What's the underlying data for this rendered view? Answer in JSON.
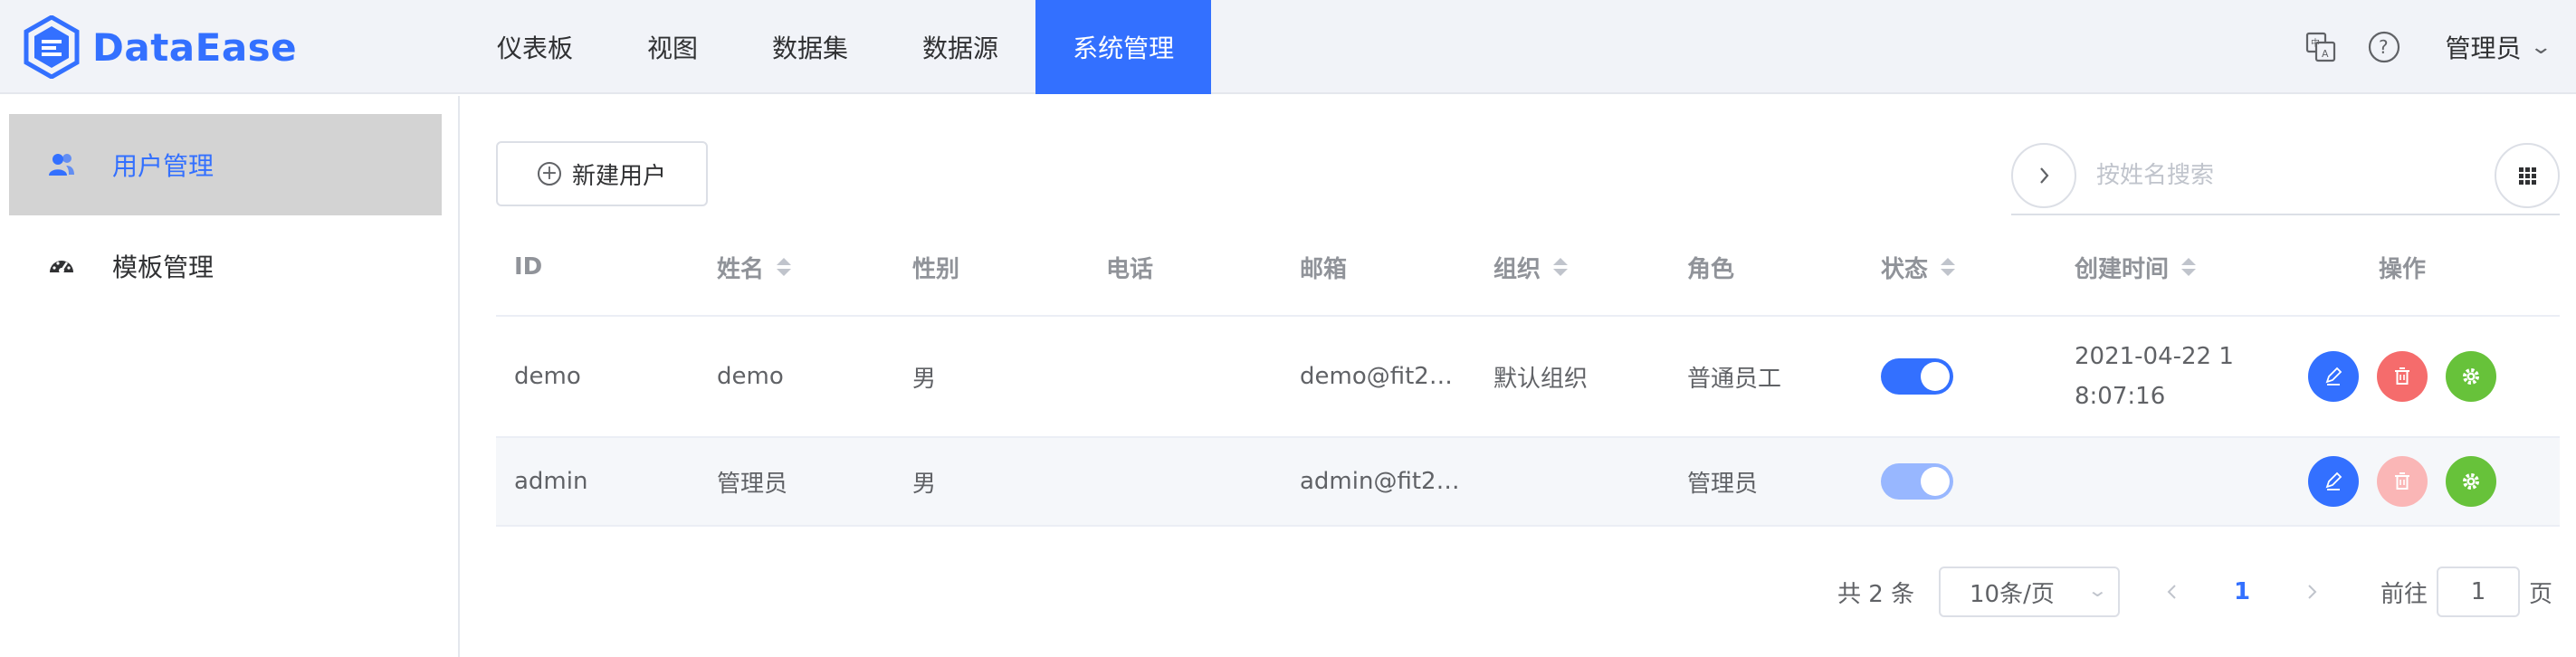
{
  "app": {
    "name": "DataEase"
  },
  "nav": {
    "items": [
      {
        "label": "仪表板"
      },
      {
        "label": "视图"
      },
      {
        "label": "数据集"
      },
      {
        "label": "数据源"
      },
      {
        "label": "系统管理"
      }
    ],
    "active_index": 4,
    "user_label": "管理员",
    "icons": [
      "translate-icon",
      "help-icon",
      "chevron-down-icon"
    ]
  },
  "sidebar": {
    "items": [
      {
        "label": "用户管理",
        "icon": "user-group-icon",
        "active": true
      },
      {
        "label": "模板管理",
        "icon": "dashboard-gauge-icon",
        "active": false
      }
    ]
  },
  "toolbar": {
    "create_label": "新建用户",
    "search_placeholder": "按姓名搜索"
  },
  "table": {
    "columns": [
      {
        "label": "ID",
        "sortable": false
      },
      {
        "label": "姓名",
        "sortable": true
      },
      {
        "label": "性别",
        "sortable": false
      },
      {
        "label": "电话",
        "sortable": false
      },
      {
        "label": "邮箱",
        "sortable": false
      },
      {
        "label": "组织",
        "sortable": true
      },
      {
        "label": "角色",
        "sortable": false
      },
      {
        "label": "状态",
        "sortable": true
      },
      {
        "label": "创建时间",
        "sortable": true
      },
      {
        "label": "操作",
        "sortable": false
      }
    ],
    "rows": [
      {
        "id": "demo",
        "name": "demo",
        "gender": "男",
        "phone": "",
        "email": "demo@fit2…",
        "org": "默认组织",
        "role": "普通员工",
        "enabled": true,
        "created": "2021-04-22 18:07:16",
        "delete_disabled": false
      },
      {
        "id": "admin",
        "name": "管理员",
        "gender": "男",
        "phone": "",
        "email": "admin@fit2…",
        "org": "",
        "role": "管理员",
        "enabled": true,
        "created": "",
        "delete_disabled": true
      }
    ]
  },
  "pagination": {
    "total_text": "共 2 条",
    "page_size": "10条/页",
    "current_page": "1",
    "goto_label": "前往",
    "goto_value": "1",
    "page_suffix": "页"
  },
  "colors": {
    "primary": "#3370ff",
    "danger": "#f56c6c",
    "success": "#67c23a",
    "nav_bg": "#f1f3f8"
  }
}
